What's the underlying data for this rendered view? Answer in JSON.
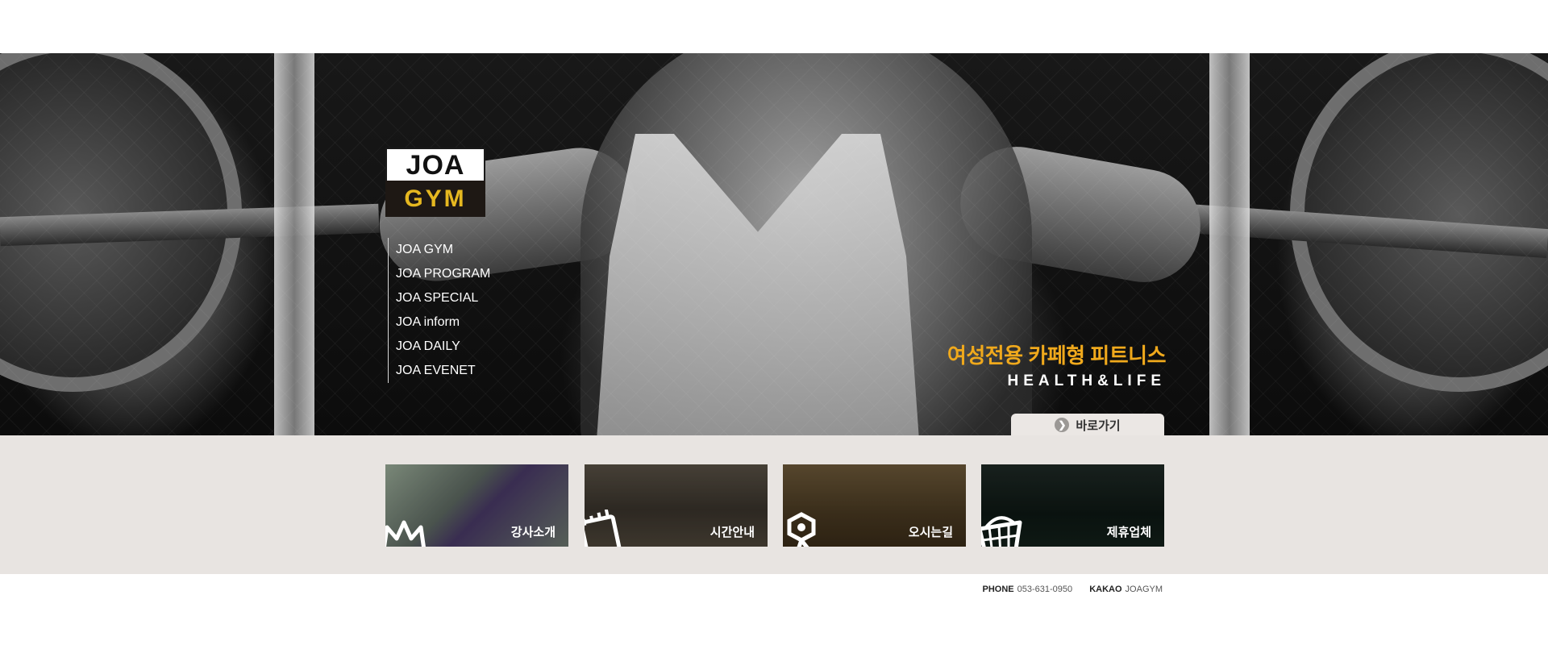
{
  "logo": {
    "line1": "JOA",
    "line2": "GYM"
  },
  "nav": {
    "items": [
      {
        "label": "JOA GYM"
      },
      {
        "label": "JOA PROGRAM"
      },
      {
        "label": "JOA SPECIAL"
      },
      {
        "label": "JOA inform"
      },
      {
        "label": "JOA DAILY"
      },
      {
        "label": "JOA EVENET"
      }
    ]
  },
  "hero": {
    "tagline_ko": "여성전용 카페형 피트니스",
    "tagline_en": "HEALTH&LIFE",
    "go_button": "바로가기",
    "go_icon": "arrow-right-icon"
  },
  "tiles": [
    {
      "label": "강사소개",
      "icon": "crown-icon"
    },
    {
      "label": "시간안내",
      "icon": "note-icon"
    },
    {
      "label": "오시는길",
      "icon": "location-icon"
    },
    {
      "label": "제휴업체",
      "icon": "basket-icon"
    }
  ],
  "footer": {
    "phone_label": "PHONE",
    "phone_value": "053-631-0950",
    "kakao_label": "KAKAO",
    "kakao_value": "JOAGYM"
  },
  "colors": {
    "accent": "#f0a91c",
    "band": "#e8e4e1",
    "logo_yellow": "#e6b820"
  }
}
